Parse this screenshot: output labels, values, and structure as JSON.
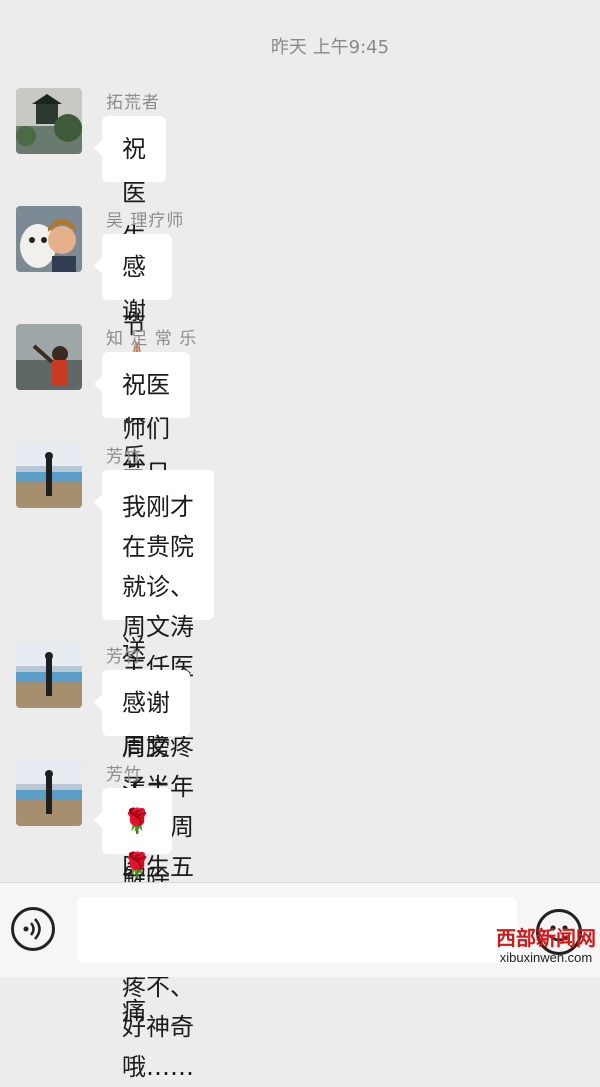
{
  "timestamp": "昨天 上午9:45",
  "messages": [
    {
      "sender": "拓荒者",
      "text": "祝医生们节日快乐"
    },
    {
      "sender": "吴 理疗师",
      "text": "感谢🙏🏼"
    },
    {
      "sender": "知 足 常 乐",
      "text": "祝医师们节日快乐，祝福送上。"
    },
    {
      "sender": "芳竹",
      "text": "我刚才在贵院就诊、周文涛主任医\n治的，肩膀疼了半年了、周医生五\n分钟就按的不疼不、好神奇哦……"
    },
    {
      "sender": "芳竹",
      "text": "感谢周文涛主任、解除了我的病痛"
    },
    {
      "sender": "芳竹",
      "text": "🌹🌹☕"
    }
  ],
  "input_bar": {
    "voice_icon": "voice-icon",
    "emoji_icon": "emoji-icon",
    "placeholder": ""
  },
  "watermark": {
    "cn": "西部新闻网",
    "en": "xibuxinwen.com"
  }
}
